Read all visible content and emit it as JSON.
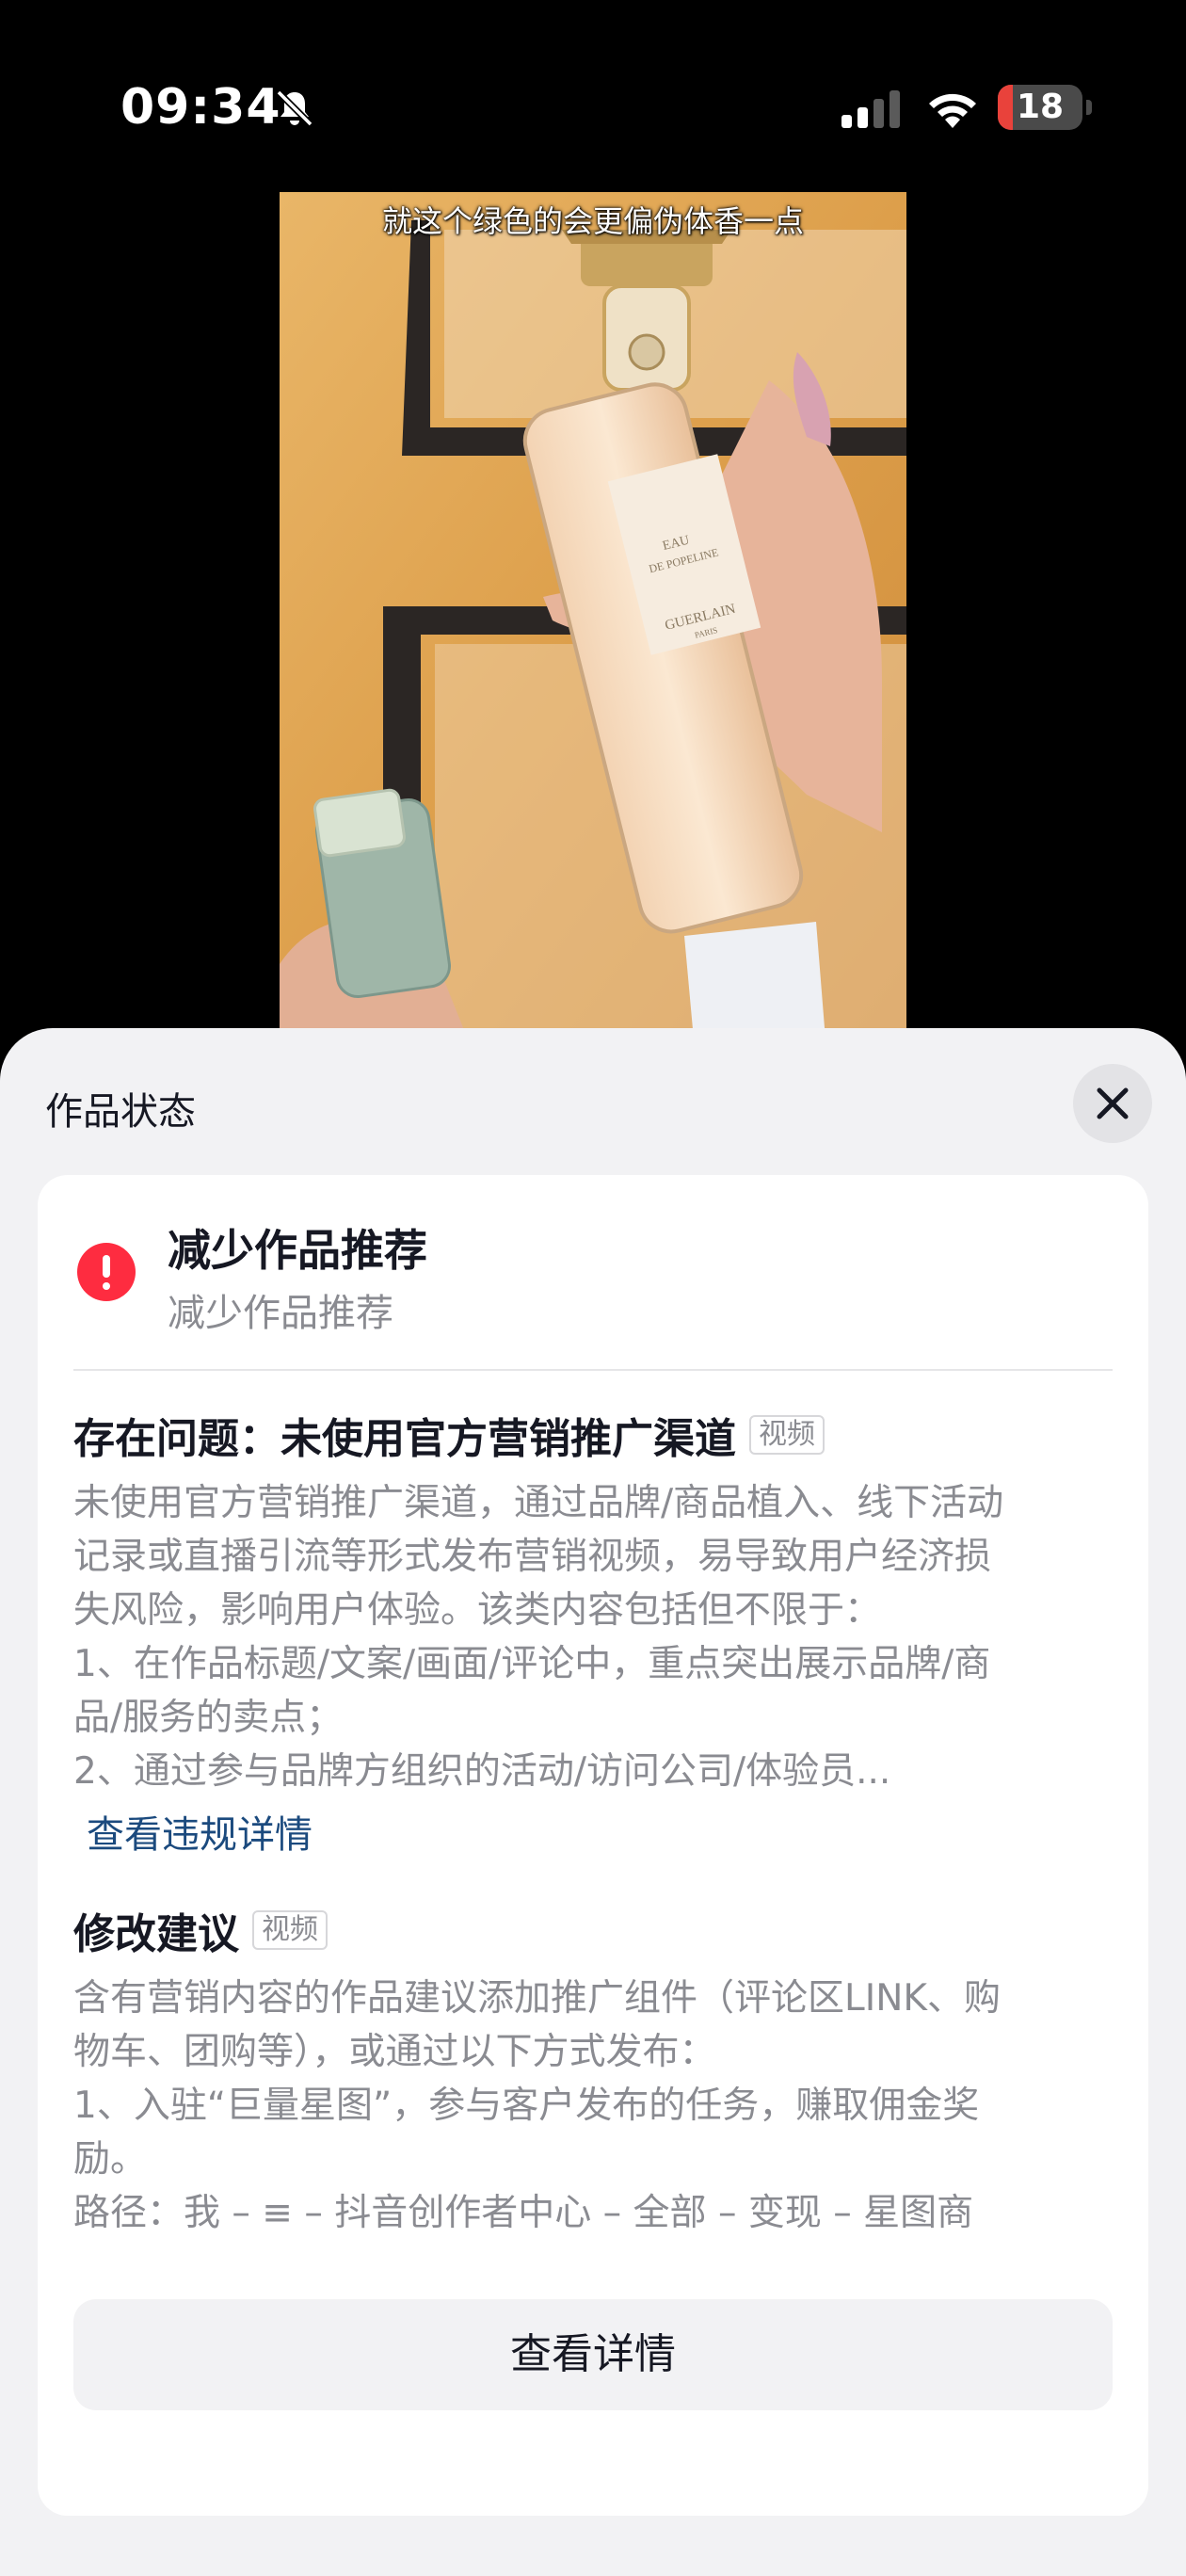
{
  "status_bar": {
    "time": "09:34",
    "battery": "18",
    "battery_level": 0.18
  },
  "video": {
    "caption": "就这个绿色的会更偏伪体香一点",
    "bottle_label_line1": "EAU",
    "bottle_label_line2": "DE POPELINE",
    "bottle_brand": "GUERLAIN",
    "bottle_brand_sub": "PARIS"
  },
  "sheet": {
    "title": "作品状态",
    "status": {
      "title": "减少作品推荐",
      "subtitle": "减少作品推荐"
    },
    "issue": {
      "heading": "存在问题：未使用官方营销推广渠道",
      "tag": "视频",
      "lines": [
        "未使用官方营销推广渠道，通过品牌/商品植入、线下活动",
        "记录或直播引流等形式发布营销视频，易导致用户经济损",
        "失风险，影响用户体验。该类内容包括但不限于：",
        "1、在作品标题/文案/画面/评论中，重点突出展示品牌/商",
        "品/服务的卖点；",
        "2、通过参与品牌方组织的活动/访问公司/体验员..."
      ],
      "link": "查看违规详情"
    },
    "suggestion": {
      "heading": "修改建议",
      "tag": "视频",
      "lines": [
        "含有营销内容的作品建议添加推广组件（评论区LINK、购",
        "物车、团购等），或通过以下方式发布：",
        "1、入驻“巨量星图”，参与客户发布的任务，赚取佣金奖",
        "励。",
        "路径：我 – ≡ – 抖音创作者中心 – 全部 – 变现 – 星图商"
      ]
    },
    "details_button": "查看详情"
  }
}
